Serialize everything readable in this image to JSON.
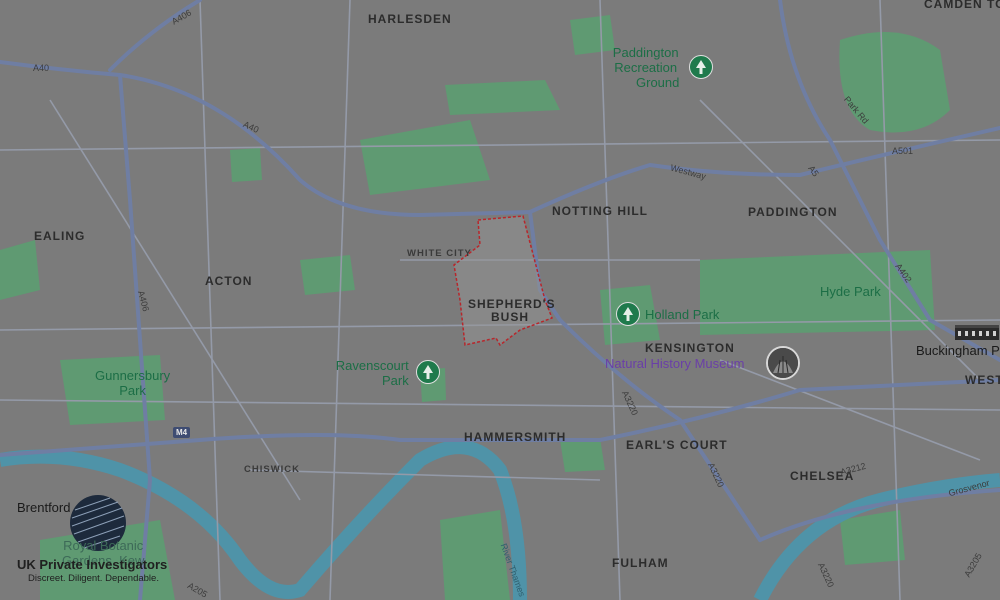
{
  "map": {
    "area_labels": {
      "harlesden": "HARLESDEN",
      "camden": "CAMDEN TO",
      "notting_hill": "NOTTING HILL",
      "paddington": "PADDINGTON",
      "ealing": "EALING",
      "acton": "ACTON",
      "white_city": "WHITE CITY",
      "shepherds_bush_1": "SHEPHERD'S",
      "shepherds_bush_2": "BUSH",
      "kensington": "KENSINGTON",
      "hammersmith": "HAMMERSMITH",
      "earls_court": "EARL'S COURT",
      "chelsea": "CHELSEA",
      "fulham": "FULHAM",
      "chiswick": "CHISWICK",
      "westminster": "WEST"
    },
    "parks": {
      "paddington_rec_1": "Paddington",
      "paddington_rec_2": "Recreation",
      "paddington_rec_3": "Ground",
      "holland_park": "Holland Park",
      "hyde_park": "Hyde Park",
      "ravenscourt_1": "Ravenscourt",
      "ravenscourt_2": "Park",
      "gunnersbury_1": "Gunnersbury",
      "gunnersbury_2": "Park",
      "kew_1": "Royal Botanic",
      "kew_2": "Gardens, Kew"
    },
    "places": {
      "brentford": "Brentford",
      "buckingham": "Buckingham P",
      "natural_history_museum": "Natural History Museum"
    },
    "roads": {
      "a406_top": "A406",
      "a40_left": "A40",
      "a40_mid": "A40",
      "westway": "Westway",
      "park_rd": "Park Rd",
      "a501": "A501",
      "a5": "A5",
      "a402": "A402",
      "a406_left": "A406",
      "a3220_a": "A3220",
      "a3220_b": "A3220",
      "a3220_c": "A3220",
      "a3212": "A3212",
      "grosvenor": "Grosvenor",
      "river_thames": "River Thames",
      "a205_left": "A205",
      "a3205": "A3205",
      "m4": "M4"
    },
    "icons": {
      "tree": "tree-icon",
      "museum": "museum-photo-icon",
      "palace": "palace-icon"
    },
    "colors": {
      "background": "#7a7a7a",
      "road": "#9aa3bd",
      "major_road": "#6f7ea3",
      "park": "#5f9a72",
      "water": "#4f93a8",
      "boundary": "#b8262b"
    }
  },
  "logo": {
    "title": "UK Private Investigators",
    "tagline": "Discreet. Diligent. Dependable."
  }
}
